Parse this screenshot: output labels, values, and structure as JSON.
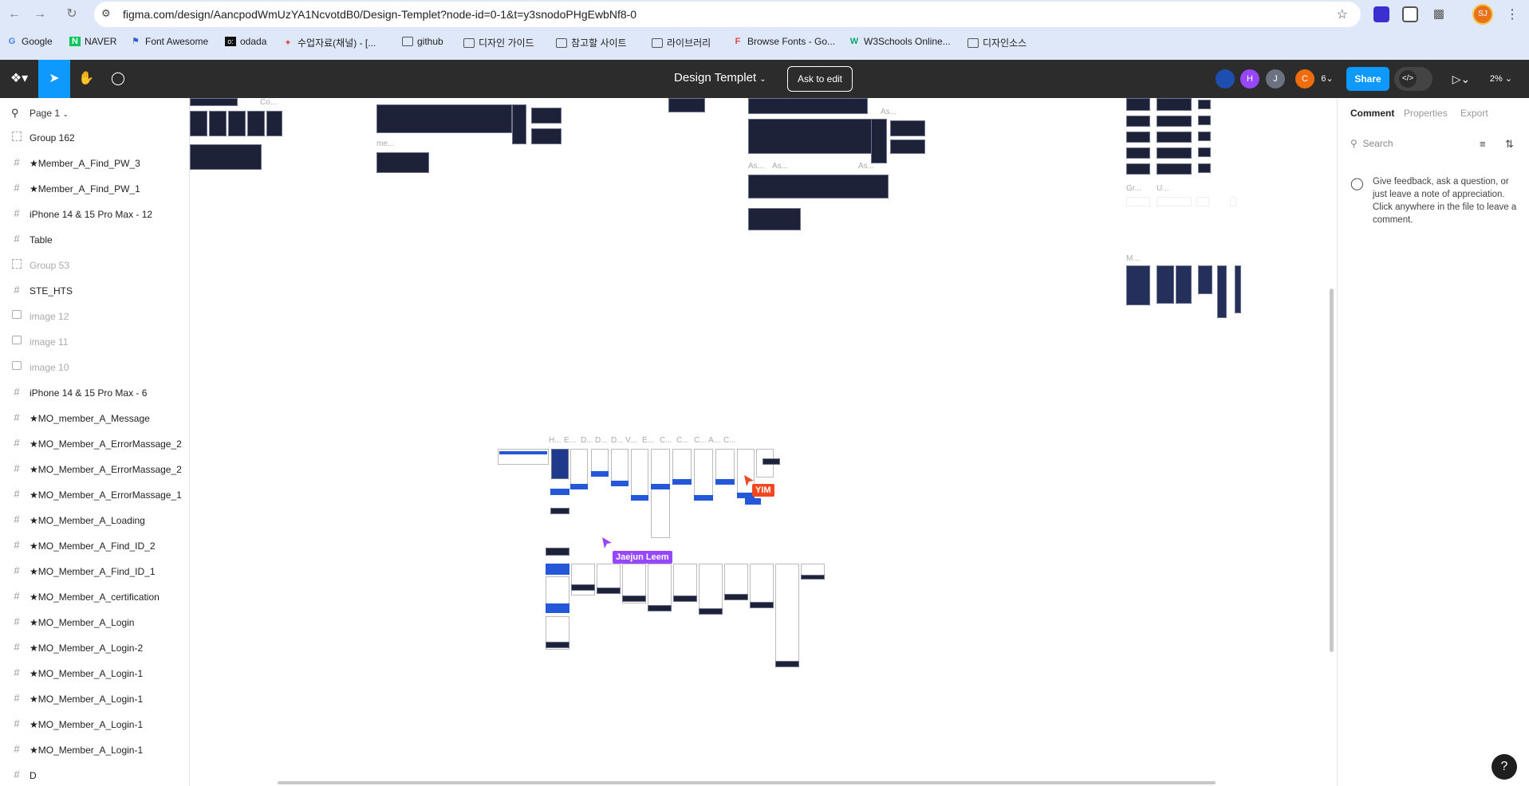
{
  "browser": {
    "url": "figma.com/design/AancpodWmUzYA1NcvotdB0/Design-Templet?node-id=0-1&t=y3snodoPHgEwbNf8-0",
    "profile_initials": "SJ"
  },
  "bookmarks": [
    {
      "label": "Google",
      "icon": "google-icon"
    },
    {
      "label": "NAVER",
      "icon": "naver-icon"
    },
    {
      "label": "Font Awesome",
      "icon": "flag-icon"
    },
    {
      "label": "odada",
      "icon": "odada-icon"
    },
    {
      "label": "수업자료(채널) - [...",
      "icon": "puzzle-icon"
    },
    {
      "label": "github",
      "icon": "folder-icon"
    },
    {
      "label": "디자인 가이드",
      "icon": "folder-icon"
    },
    {
      "label": "참고할 사이트",
      "icon": "folder-icon"
    },
    {
      "label": "라이브러리",
      "icon": "folder-icon"
    },
    {
      "label": "Browse Fonts - Go...",
      "icon": "google-fonts-icon"
    },
    {
      "label": "W3Schools Online...",
      "icon": "w3schools-icon"
    },
    {
      "label": "디자인소스",
      "icon": "folder-icon"
    }
  ],
  "toolbar": {
    "doc_title": "Design Templet",
    "ask_to_edit": "Ask to edit",
    "share": "Share",
    "avatars": [
      {
        "initial": "",
        "color": "#1e4fb0"
      },
      {
        "initial": "H",
        "color": "#9747ff"
      },
      {
        "initial": "J",
        "color": "#6b7280"
      },
      {
        "initial": "C",
        "color": "#f06d0e"
      }
    ],
    "collaborator_count": "6",
    "zoom": "2%"
  },
  "layers": {
    "page_label": "Page 1",
    "items": [
      {
        "name": "Group 162",
        "type": "group"
      },
      {
        "name": "★Member_A_Find_PW_3",
        "type": "frame"
      },
      {
        "name": "★Member_A_Find_PW_1",
        "type": "frame"
      },
      {
        "name": "iPhone 14 & 15 Pro Max - 12",
        "type": "frame"
      },
      {
        "name": "Table",
        "type": "frame"
      },
      {
        "name": "Group 53",
        "type": "group",
        "dim": true
      },
      {
        "name": "STE_HTS",
        "type": "frame"
      },
      {
        "name": "image 12",
        "type": "image",
        "dim": true
      },
      {
        "name": "image 11",
        "type": "image",
        "dim": true
      },
      {
        "name": "image 10",
        "type": "image",
        "dim": true
      },
      {
        "name": "iPhone 14 & 15 Pro Max - 6",
        "type": "frame"
      },
      {
        "name": "★MO_member_A_Message",
        "type": "frame"
      },
      {
        "name": "★MO_Member_A_ErrorMassage_2",
        "type": "frame"
      },
      {
        "name": "★MO_Member_A_ErrorMassage_2",
        "type": "frame"
      },
      {
        "name": "★MO_Member_A_ErrorMassage_1",
        "type": "frame"
      },
      {
        "name": "★MO_Member_A_Loading",
        "type": "frame"
      },
      {
        "name": "★MO_Member_A_Find_ID_2",
        "type": "frame"
      },
      {
        "name": "★MO_Member_A_Find_ID_1",
        "type": "frame"
      },
      {
        "name": "★MO_Member_A_certification",
        "type": "frame"
      },
      {
        "name": "★MO_Member_A_Login",
        "type": "frame"
      },
      {
        "name": "★MO_Member_A_Login-2",
        "type": "frame"
      },
      {
        "name": "★MO_Member_A_Login-1",
        "type": "frame"
      },
      {
        "name": "★MO_Member_A_Login-1",
        "type": "frame"
      },
      {
        "name": "★MO_Member_A_Login-1",
        "type": "frame"
      },
      {
        "name": "★MO_Member_A_Login-1",
        "type": "frame"
      },
      {
        "name": "D",
        "type": "frame"
      }
    ]
  },
  "canvas": {
    "labels_top": [
      "Co...",
      "me...",
      "As...",
      "As...",
      "As...",
      "As...",
      "M...",
      "Gr...",
      "U..."
    ],
    "labels_mid": [
      "H...",
      "E...",
      "D...",
      "D...",
      "D...",
      "V...",
      "E...",
      "C...",
      "C...",
      "C...",
      "A...",
      "C..."
    ],
    "cursors": [
      {
        "name": "Jaejun Leem",
        "color": "#9747ff"
      },
      {
        "name": "YIM",
        "color": "#f24822"
      }
    ]
  },
  "right_panel": {
    "tabs": [
      "Comment",
      "Properties",
      "Export"
    ],
    "active_tab": "Comment",
    "search_placeholder": "Search",
    "hint": "Give feedback, ask a question, or just leave a note of appreciation. Click anywhere in the file to leave a comment."
  },
  "help": "?"
}
